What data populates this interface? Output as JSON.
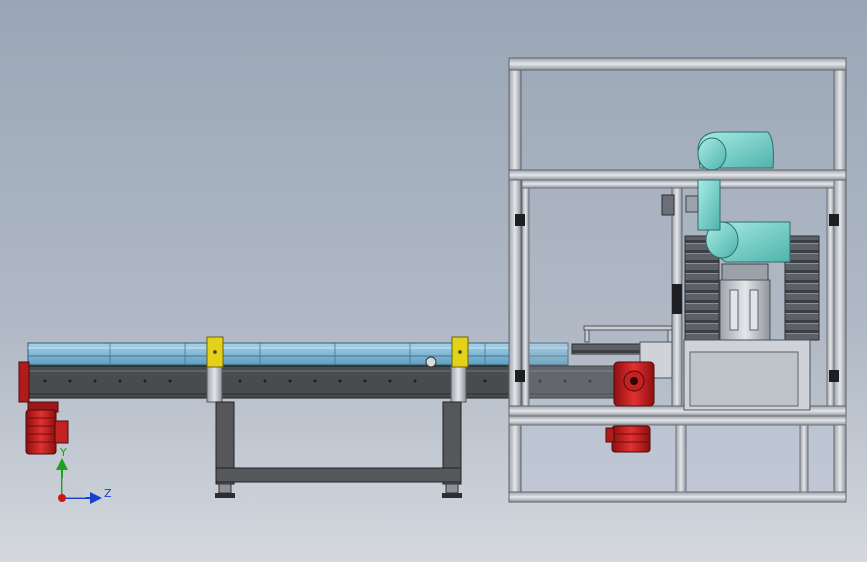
{
  "viewport": {
    "background_top": "#9aa6b6",
    "background_bottom": "#d6dae0"
  },
  "triad": {
    "y_label": "Y",
    "z_label": "Z",
    "y_color": "#1fa01f",
    "z_color": "#1a3fd0",
    "origin_color": "#d01515"
  },
  "colors": {
    "conveyor_belt": "#7fb8d8",
    "conveyor_frame": "#4a4a4a",
    "motor_red": "#d21f1f",
    "robot_cyan": "#7fd6cf",
    "support_yellow": "#e2d21a",
    "cage_frame": "#c9cdd3"
  },
  "components": [
    "conveyor",
    "drive-motor-left",
    "conveyor-support-stand",
    "yellow-clamp-blocks",
    "enclosure-frame",
    "robot-arm",
    "gear-motor-right",
    "pallet-racks"
  ]
}
